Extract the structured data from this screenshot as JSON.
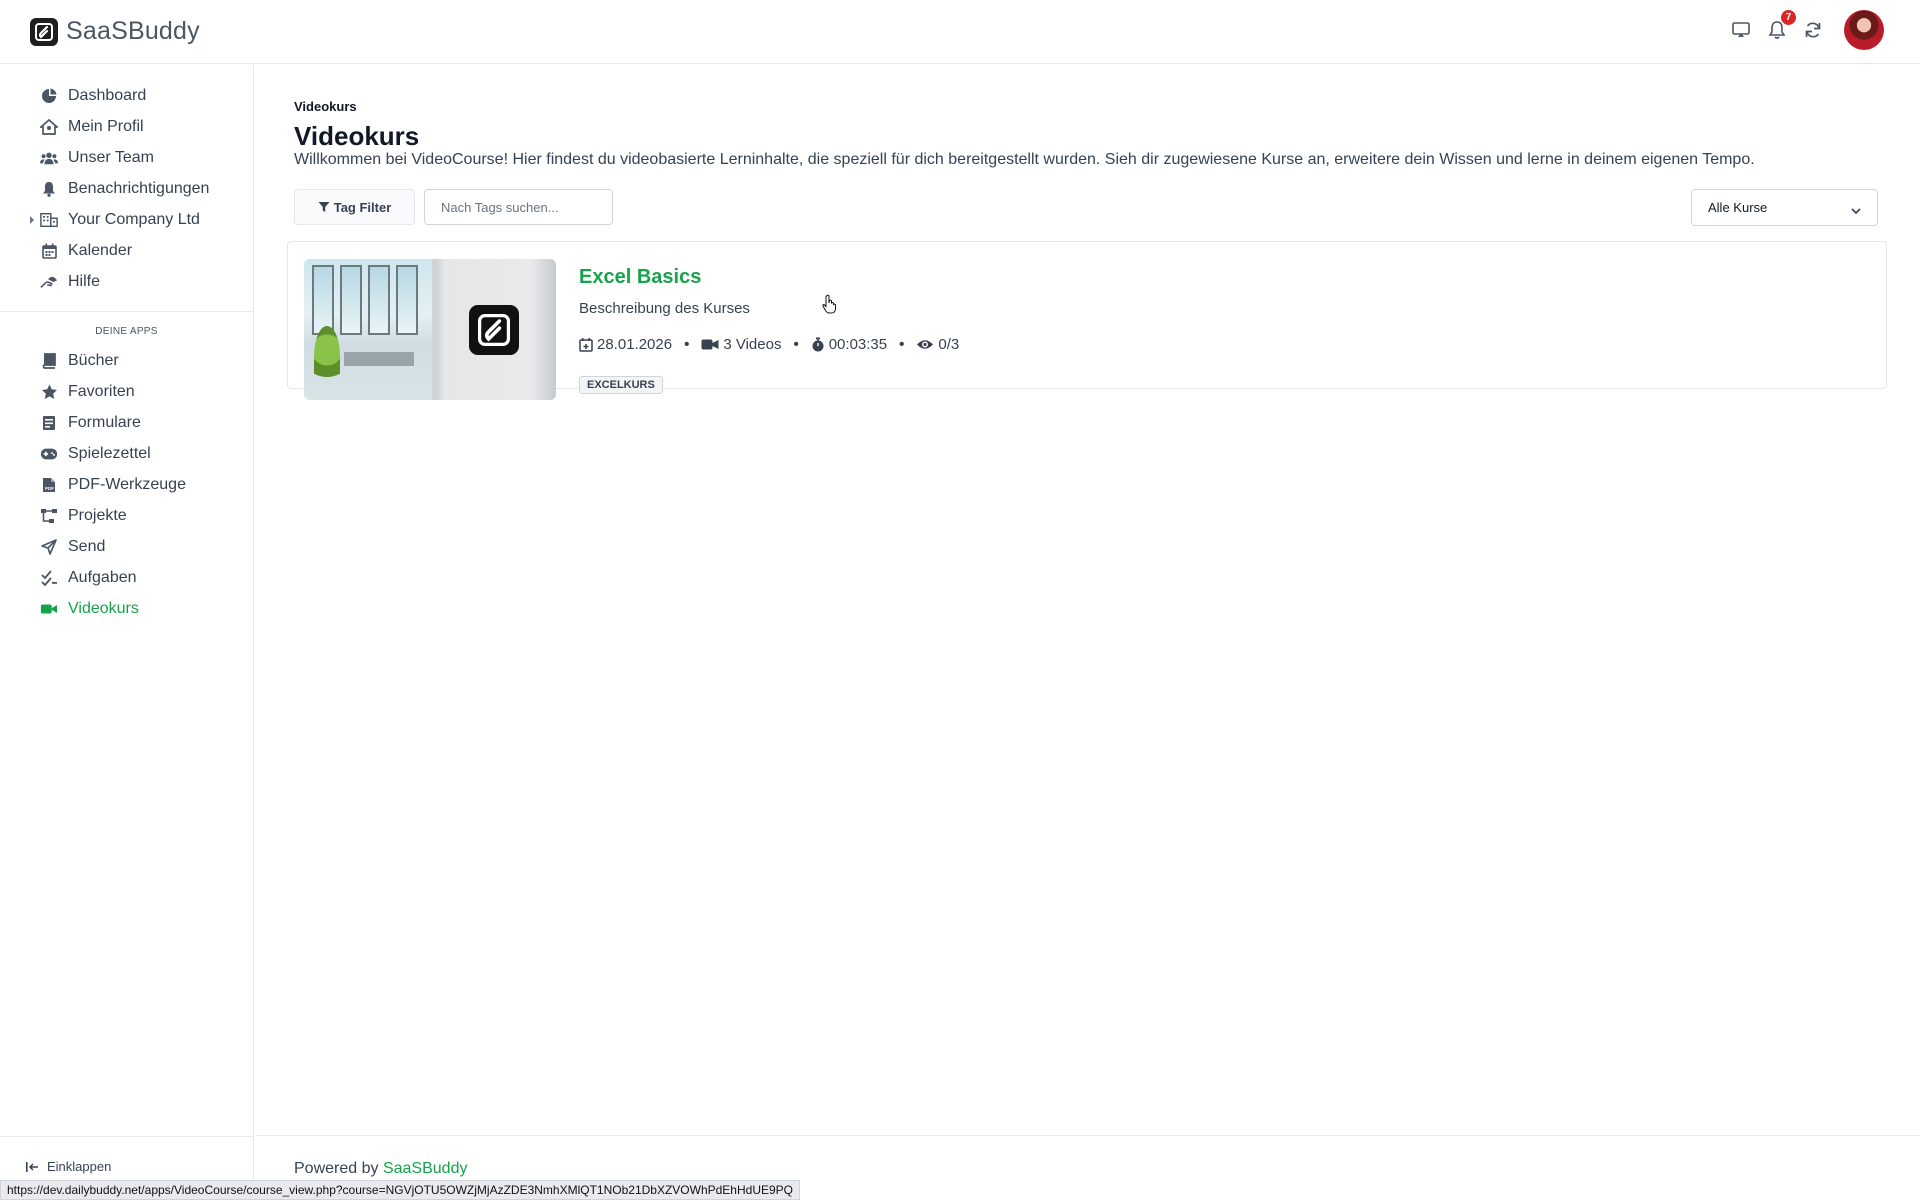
{
  "app": {
    "name": "SaaSBuddy",
    "notification_count": "7"
  },
  "sidebar": {
    "items": [
      {
        "label": "Dashboard",
        "icon": "dashboard-gauge-icon"
      },
      {
        "label": "Mein Profil",
        "icon": "home-user-icon"
      },
      {
        "label": "Unser Team",
        "icon": "team-icon"
      },
      {
        "label": "Benachrichtigungen",
        "icon": "bell-icon"
      },
      {
        "label": "Your Company Ltd",
        "icon": "building-icon"
      },
      {
        "label": "Kalender",
        "icon": "calendar-icon"
      },
      {
        "label": "Hilfe",
        "icon": "help-hands-icon"
      }
    ],
    "section_label": "DEINE APPS",
    "apps": [
      {
        "label": "Bücher",
        "icon": "book-icon"
      },
      {
        "label": "Favoriten",
        "icon": "star-icon"
      },
      {
        "label": "Formulare",
        "icon": "form-icon"
      },
      {
        "label": "Spielezettel",
        "icon": "gamepad-icon"
      },
      {
        "label": "PDF-Werkzeuge",
        "icon": "pdf-file-icon"
      },
      {
        "label": "Projekte",
        "icon": "project-tree-icon"
      },
      {
        "label": "Send",
        "icon": "send-icon"
      },
      {
        "label": "Aufgaben",
        "icon": "checklist-icon"
      },
      {
        "label": "Videokurs",
        "icon": "video-camera-icon",
        "active": true
      }
    ],
    "collapse_label": "Einklappen"
  },
  "main": {
    "breadcrumb": "Videokurs",
    "title": "Videokurs",
    "description": "Willkommen bei VideoCourse! Hier findest du videobasierte Lerninhalte, die speziell für dich bereitgestellt wurden. Sieh dir zugewiesene Kurse an, erweitere dein Wissen und lerne in deinem eigenen Tempo.",
    "tag_filter_label": "Tag Filter",
    "tag_search_placeholder": "Nach Tags suchen...",
    "course_select_value": "Alle Kurse"
  },
  "courses": [
    {
      "title": "Excel Basics",
      "description": "Beschreibung des Kurses",
      "date": "28.01.2026",
      "videos": "3 Videos",
      "duration": "00:03:35",
      "views": "0/3",
      "tag": "EXCELKURS"
    }
  ],
  "footer": {
    "powered_by": "Powered by",
    "brand_link": "SaaSBuddy"
  },
  "status_url": "https://dev.dailybuddy.net/apps/VideoCourse/course_view.php?course=NGVjOTU5OWZjMjAzZDE3NmhXMlQT1NOb21DbXZVOWhPdEhHdUE9PQ",
  "colors": {
    "accent": "#16a34a",
    "badge": "#dc2626",
    "text": "#374151"
  }
}
